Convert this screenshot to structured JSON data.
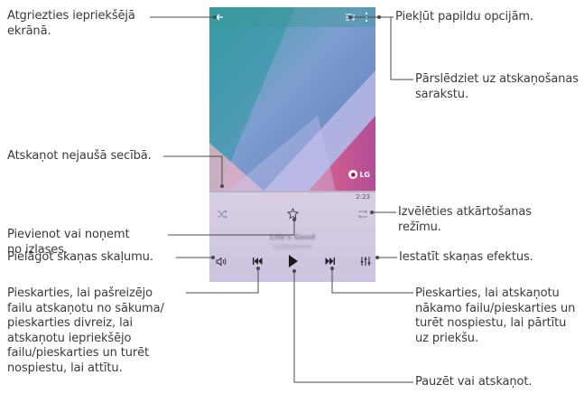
{
  "player": {
    "duration": "2:23",
    "track_title": "Life's Good",
    "track_artist": "LG Electronics",
    "logo_text": "LG"
  },
  "callouts": {
    "back": "Atgriezties iepriekšējā\nekrānā.",
    "more_options": "Piekļūt papildu opcijām.",
    "playlist": "Pārslēdziet uz atskaņošanas\nsarakstu.",
    "shuffle": "Atskaņot nejaušā secībā.",
    "repeat": "Izvēlēties atkārtošanas\nrežīmu.",
    "favorite": "Pievienot vai noņemt\nno izlases.",
    "volume": "Pielāgot skaņas skaļumu.",
    "effects": "Iestatīt skaņas efektus.",
    "previous": "Pieskarties, lai pašreizējo\nfailu atskaņotu no sākuma/\npieskarties divreiz, lai\natskaņotu iepriekšējo\nfailu/pieskarties un turēt\nnospiestu, lai attītu.",
    "next": "Pieskarties, lai atskaņotu\nnākamo failu/pieskarties un\nturēt nospiestu, lai pārtītu\nuz priekšu.",
    "play_pause": "Pauzēt vai atskaņot."
  },
  "icons": {
    "back": "back-arrow-icon",
    "playlist": "playlist-icon",
    "more": "more-vertical-icon",
    "shuffle": "shuffle-icon",
    "favorite": "star-icon",
    "repeat": "repeat-icon",
    "volume": "volume-icon",
    "previous": "skip-previous-icon",
    "play": "play-icon",
    "next": "skip-next-icon",
    "effects": "equalizer-icon"
  },
  "colors": {
    "line": "#4a4a4a",
    "topbar": "#3c9696",
    "player_panel": "#d4cbe2",
    "text": "#3a3a3a"
  }
}
